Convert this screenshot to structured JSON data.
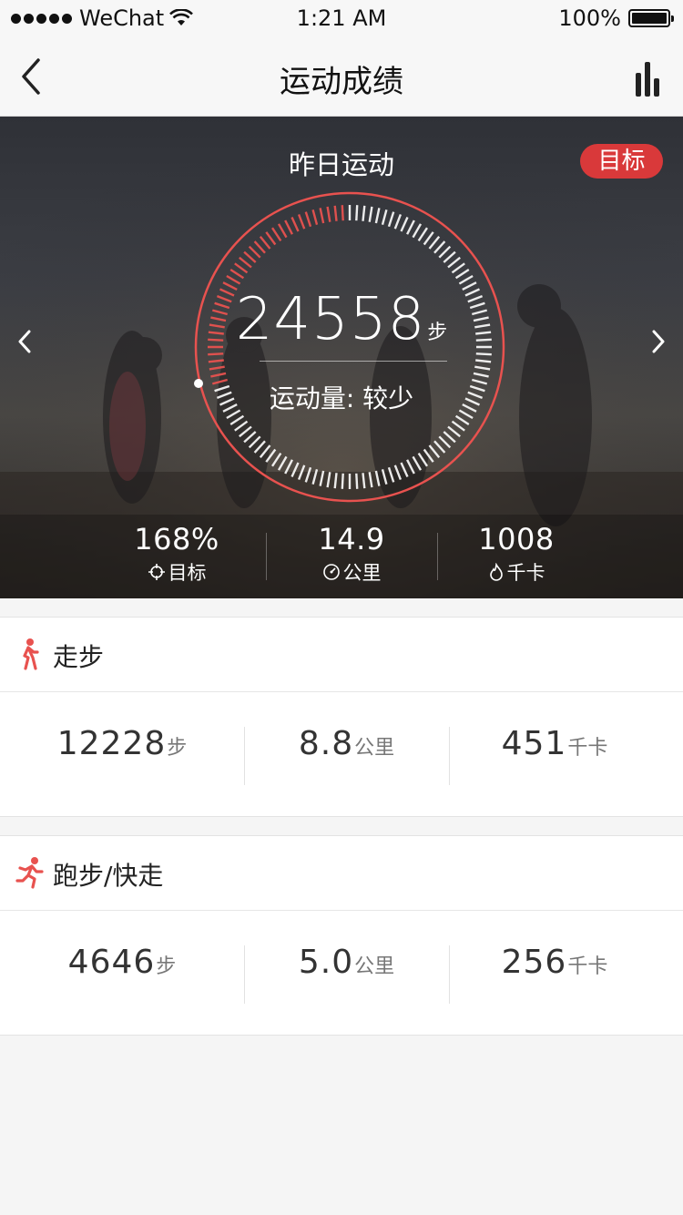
{
  "status_bar": {
    "carrier": "WeChat",
    "time": "1:21 AM",
    "battery": "100%"
  },
  "nav": {
    "title": "运动成绩",
    "back_icon": "chevron-left-icon",
    "chart_icon": "bar-chart-icon"
  },
  "hero": {
    "label": "昨日运动",
    "goal_button": "目标",
    "steps": "24558",
    "steps_unit": "步",
    "level_text": "运动量: 较少",
    "progress_fraction": 1.0,
    "accent_color": "#e8524f",
    "stats": [
      {
        "value": "168%",
        "label": "目标",
        "icon": "target-icon"
      },
      {
        "value": "14.9",
        "label": "公里",
        "icon": "speedometer-icon"
      },
      {
        "value": "1008",
        "label": "千卡",
        "icon": "flame-icon"
      }
    ]
  },
  "walk": {
    "title": "走步",
    "icon": "walking-icon",
    "steps": "12228",
    "steps_unit": "步",
    "distance": "8.8",
    "distance_unit": "公里",
    "calories": "451",
    "calories_unit": "千卡"
  },
  "run": {
    "title": "跑步/快走",
    "icon": "running-icon",
    "steps": "4646",
    "steps_unit": "步",
    "distance": "5.0",
    "distance_unit": "公里",
    "calories": "256",
    "calories_unit": "千卡"
  }
}
